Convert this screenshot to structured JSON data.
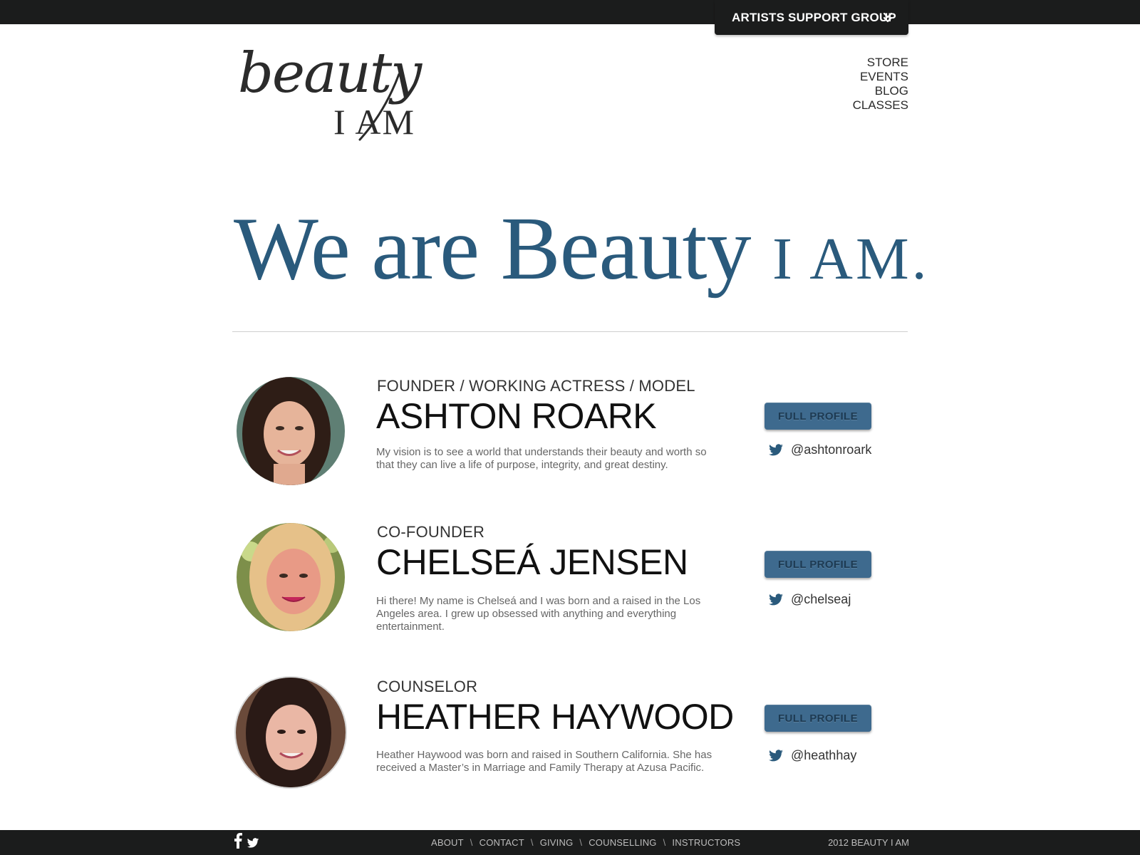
{
  "topbar": {
    "group_label": "ARTISTS SUPPORT GROUP"
  },
  "logo": {
    "script": "beauty",
    "sub": "I AM"
  },
  "nav": {
    "items": [
      "STORE",
      "EVENTS",
      "BLOG",
      "CLASSES"
    ]
  },
  "hero": {
    "part1": "We are Beauty",
    "part2": "I AM."
  },
  "people": [
    {
      "role": "FOUNDER / WORKING ACTRESS / MODEL",
      "name": "ASHTON ROARK",
      "bio": "My vision is to see a world that understands their beauty and worth so that they can live a life of purpose, integrity, and great destiny.",
      "button": "FULL PROFILE",
      "twitter": "@ashtonroark"
    },
    {
      "role": "CO-FOUNDER",
      "name": "CHELSEÁ JENSEN",
      "bio": "Hi there! My name is Chelseá and I was born and a raised in the Los Angeles area. I grew up obsessed with anything and everything entertainment.",
      "button": "FULL PROFILE",
      "twitter": "@chelseaj"
    },
    {
      "role": "COUNSELOR",
      "name": "HEATHER HAYWOOD",
      "bio": "Heather Haywood was born and raised in Southern California.  She has received a Master’s in Marriage and Family Therapy at Azusa Pacific.",
      "button": "FULL PROFILE",
      "twitter": "@heathhay"
    }
  ],
  "footer": {
    "links": [
      "ABOUT",
      "CONTACT",
      "GIVING",
      "COUNSELLING",
      "INSTRUCTORS"
    ],
    "separator": "\\",
    "copyright": "2012 BEAUTY I AM"
  },
  "colors": {
    "bar": "#1b1c1c",
    "hero_blue": "#2a5a7c",
    "button_blue": "#3e6a8e",
    "twitter_blue": "#2a5a7c"
  },
  "icons": {
    "chevron": "double-chevron-down-icon",
    "twitter": "twitter-bird-icon",
    "facebook": "facebook-icon"
  }
}
